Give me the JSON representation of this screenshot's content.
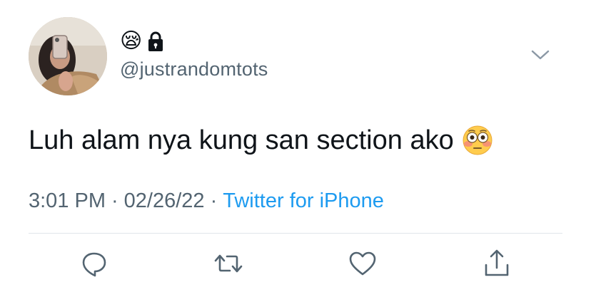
{
  "user": {
    "name_emoji": "😪",
    "handle": "@justrandomtots",
    "avatar_icon": "avatar-photo",
    "protected_icon": "lock-icon"
  },
  "tweet": {
    "text": "Luh alam nya kung san section ako",
    "emoji": "flushed-face-emoji"
  },
  "meta": {
    "time": "3:01 PM",
    "separator": "·",
    "date": "02/26/22",
    "source": "Twitter for iPhone"
  },
  "actions": [
    {
      "icon": "reply-icon"
    },
    {
      "icon": "retweet-icon"
    },
    {
      "icon": "like-icon"
    },
    {
      "icon": "share-icon"
    }
  ],
  "colors": {
    "text": "#0f1419",
    "secondary": "#536471",
    "link": "#1d9bf0",
    "divider": "#e1e6ea"
  }
}
